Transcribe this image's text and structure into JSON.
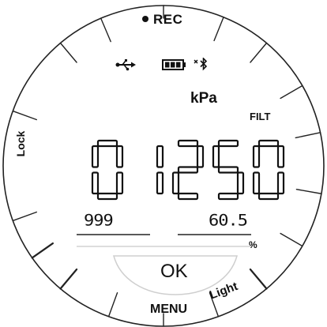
{
  "status": {
    "rec_label": "REC",
    "unit": "kPa",
    "filter": "FILT"
  },
  "icons": [
    "usb-icon",
    "battery-icon",
    "bluetooth-icon",
    "record-dot-icon"
  ],
  "reading": {
    "main": "01250",
    "left_value": "999",
    "right_value": "60.5",
    "right_unit": "%"
  },
  "buttons": {
    "lock": "Lock",
    "ok": "OK",
    "menu": "MENU",
    "light": "Light"
  },
  "colors": {
    "segments": "#111111",
    "background": "#ffffff",
    "ok_outline": "#cfcfcf"
  }
}
